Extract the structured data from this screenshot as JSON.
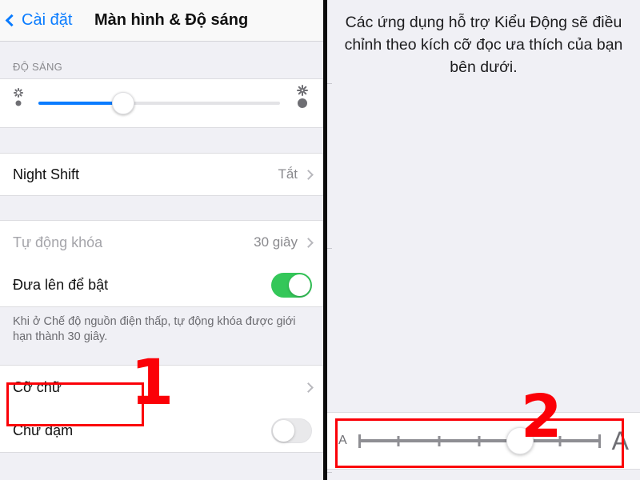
{
  "left_panel": {
    "navbar": {
      "back_label": "Cài đặt",
      "back_icon": "chevron-left-icon",
      "title": "Màn hình & Độ sáng"
    },
    "brightness_section": {
      "header": "ĐỘ SÁNG",
      "slider": {
        "value_percent": 35,
        "fill_color": "#0a7cff",
        "left_icon": "sun-small-icon",
        "right_icon": "sun-large-icon"
      }
    },
    "night_shift": {
      "label": "Night Shift",
      "value": "Tắt",
      "accessory": "chevron-right-icon"
    },
    "auto_lock": {
      "label": "Tự động khóa",
      "value": "30 giây",
      "accessory": "chevron-right-icon",
      "disabled": true
    },
    "raise_to_wake": {
      "label": "Đưa lên để bật",
      "toggle_state": "on",
      "toggle_color": "#34c759"
    },
    "footnote": "Khi ở Chế độ nguồn điện thấp, tự động khóa được giới hạn thành 30 giây.",
    "text_size": {
      "label": "Cỡ chữ",
      "accessory": "chevron-right-icon"
    },
    "bold_text": {
      "label": "Chữ đậm",
      "toggle_state": "off",
      "toggle_color": "#e9e9eb"
    }
  },
  "right_panel": {
    "description": "Các ứng dụng hỗ trợ Kiểu Động sẽ điều chỉnh theo kích cỡ đọc ưa thích của bạn bên dưới.",
    "size_slider": {
      "min_label": "A",
      "max_label": "A",
      "tick_count": 7,
      "selected_index": 4,
      "track_color": "#8e8e93"
    }
  },
  "annotations": {
    "marker_1": "1",
    "marker_2": "2",
    "color": "#fb0007"
  }
}
